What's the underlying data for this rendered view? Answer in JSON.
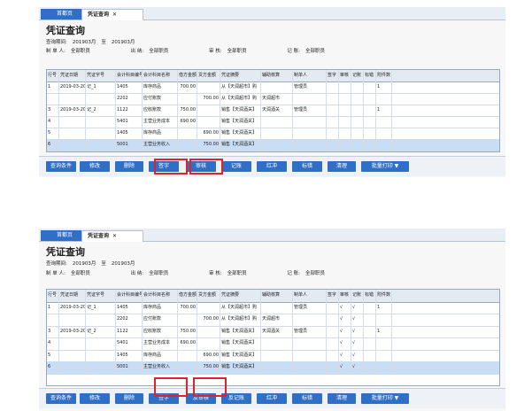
{
  "panels": [
    {
      "tabs": {
        "home": "首都页",
        "active": "凭证查询",
        "close": "✕"
      },
      "title": "凭证查询",
      "range": {
        "label": "查询期间:",
        "from": "201903月",
        "to_label": "至",
        "to": "201903月"
      },
      "filters": [
        {
          "label": "制 单 人:",
          "value": "全部职员"
        },
        {
          "label": "出    纳:",
          "value": "全部职员"
        },
        {
          "label": "审    核:",
          "value": "全部职员"
        },
        {
          "label": "记    账:",
          "value": "全部职员"
        }
      ],
      "columns": [
        "行号",
        "凭证日期",
        "凭证字号",
        "会计科目编号",
        "会计科目名称",
        "借方金额",
        "贷方金额",
        "凭证摘要",
        "辅助核算",
        "制单人",
        "签字",
        "审核",
        "记账",
        "标错",
        "附件数"
      ],
      "rows": [
        [
          "1",
          "2019-03-20",
          "记_1",
          "1405",
          "库存商品",
          "700.00",
          "",
          "从【天润超市】购",
          "",
          "管理员",
          "",
          "",
          "",
          "",
          "1"
        ],
        [
          "",
          "",
          "",
          "2202",
          "应付账款",
          "",
          "700.00",
          "从【天润超市】购",
          "天润超市",
          "",
          "",
          "",
          "",
          "",
          ""
        ],
        [
          "3",
          "2019-03-20",
          "记_2",
          "1122",
          "应收账款",
          "750.00",
          "",
          "销售【天润酒关】",
          "天润酒关",
          "管理员",
          "",
          "",
          "",
          "",
          "1"
        ],
        [
          "4",
          "",
          "",
          "5401",
          "主营业务成本",
          "690.00",
          "",
          "销售【天润酒关】",
          "",
          "",
          "",
          "",
          "",
          "",
          ""
        ],
        [
          "5",
          "",
          "",
          "1405",
          "库存商品",
          "",
          "690.00",
          "销售【天润酒关】",
          "",
          "",
          "",
          "",
          "",
          "",
          ""
        ],
        [
          "6",
          "",
          "",
          "5001",
          "主营业务收入",
          "",
          "750.00",
          "销售【天润酒关】",
          "",
          "",
          "",
          "",
          "",
          "",
          ""
        ]
      ],
      "toolbar": [
        "查询条件",
        "修改",
        "删除",
        "签字",
        "审核",
        "记账",
        "红冲",
        "标错",
        "清理",
        "批量打印 ▼"
      ]
    },
    {
      "tabs": {
        "home": "首都页",
        "active": "凭证查询",
        "close": "✕"
      },
      "title": "凭证查询",
      "range": {
        "label": "查询期间:",
        "from": "201903月",
        "to_label": "至",
        "to": "201903月"
      },
      "filters": [
        {
          "label": "制 单 人:",
          "value": "全部职员"
        },
        {
          "label": "出    纳:",
          "value": "全部职员"
        },
        {
          "label": "审    核:",
          "value": "全部职员"
        },
        {
          "label": "记    账:",
          "value": "全部职员"
        }
      ],
      "columns": [
        "行号",
        "凭证日期",
        "凭证字号",
        "会计科目编号",
        "会计科目名称",
        "借方金额",
        "贷方金额",
        "凭证摘要",
        "辅助核算",
        "制单人",
        "签字",
        "审核",
        "记账",
        "标错",
        "附件数"
      ],
      "rows": [
        [
          "1",
          "2019-03-20",
          "记_1",
          "1405",
          "库存商品",
          "700.00",
          "",
          "从【天润超市】购",
          "",
          "管理员",
          "",
          "√",
          "√",
          "",
          "1"
        ],
        [
          "",
          "",
          "",
          "2202",
          "应付账款",
          "",
          "700.00",
          "从【天润超市】购",
          "天润超市",
          "",
          "",
          "√",
          "√",
          "",
          ""
        ],
        [
          "3",
          "2019-03-20",
          "记_2",
          "1122",
          "应收账款",
          "750.00",
          "",
          "销售【天润酒关】",
          "天润酒关",
          "管理员",
          "",
          "√",
          "√",
          "",
          "1"
        ],
        [
          "4",
          "",
          "",
          "5401",
          "主营业务成本",
          "690.00",
          "",
          "销售【天润酒关】",
          "",
          "",
          "",
          "√",
          "√",
          "",
          ""
        ],
        [
          "5",
          "",
          "",
          "1405",
          "库存商品",
          "",
          "690.00",
          "销售【天润酒关】",
          "",
          "",
          "",
          "√",
          "√",
          "",
          ""
        ],
        [
          "6",
          "",
          "",
          "5001",
          "主营业务收入",
          "",
          "750.00",
          "销售【天润酒关】",
          "",
          "",
          "",
          "√",
          "√",
          "",
          ""
        ]
      ],
      "toolbar": [
        "查询条件",
        "修改",
        "删除",
        "签字",
        "反审核",
        "反记账",
        "红冲",
        "标错",
        "清理",
        "批量打印 ▼"
      ]
    }
  ]
}
